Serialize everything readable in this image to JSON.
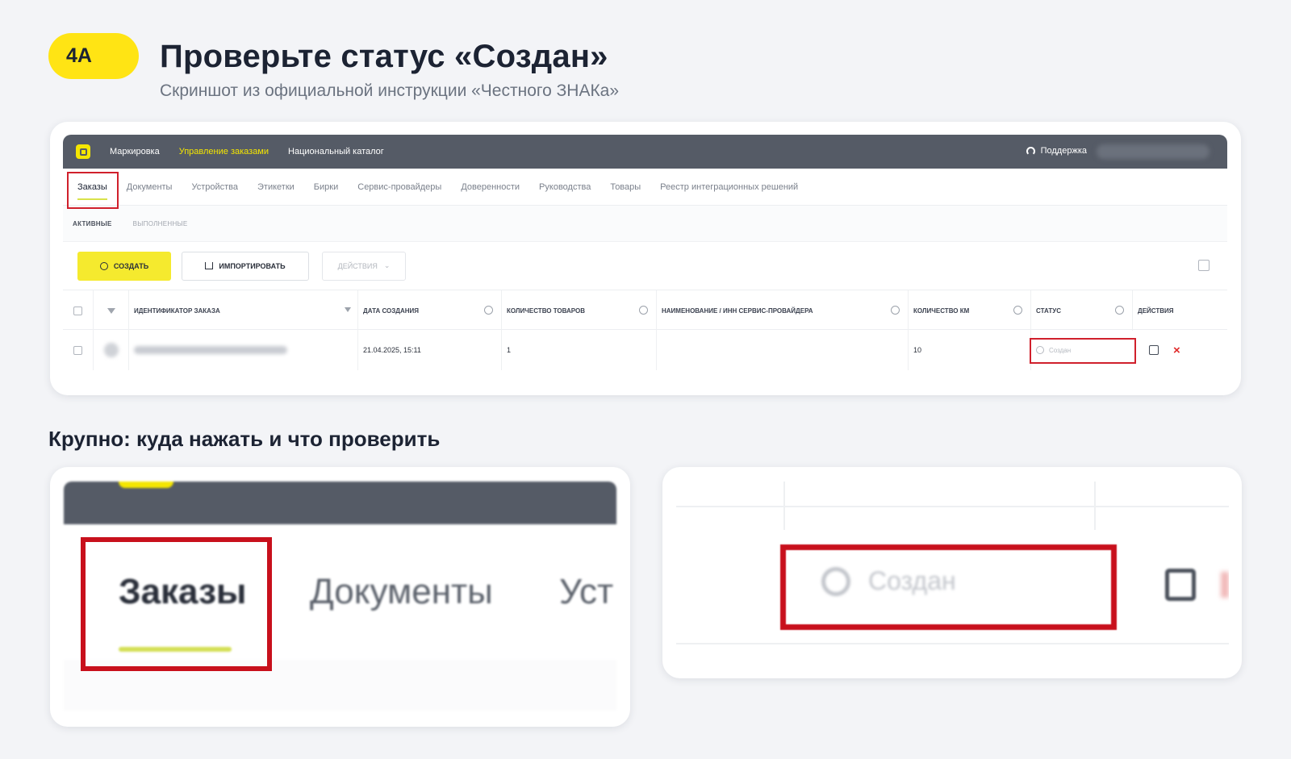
{
  "header": {
    "step": "4А",
    "title": "Проверьте статус «Создан»",
    "subtitle": "Скриншот из официальной инструкции «Честного ЗНАКа»"
  },
  "app": {
    "topnav": [
      "Маркировка",
      "Управление заказами",
      "Национальный каталог"
    ],
    "support": "Поддержка",
    "tabs": [
      "Заказы",
      "Документы",
      "Устройства",
      "Этикетки",
      "Бирки",
      "Сервис-провайдеры",
      "Доверенности",
      "Руководства",
      "Товары",
      "Реестр интеграционных решений"
    ],
    "subtabs": [
      "АКТИВНЫЕ",
      "ВЫПОЛНЕННЫЕ"
    ],
    "toolbar": {
      "create": "СОЗДАТЬ",
      "import": "ИМПОРТИРОВАТЬ",
      "actions": "ДЕЙСТВИЯ"
    },
    "table": {
      "headers": {
        "order_id": "ИДЕНТИФИКАТОР ЗАКАЗА",
        "created": "ДАТА СОЗДАНИЯ",
        "goods_count": "КОЛИЧЕСТВО ТОВАРОВ",
        "provider": "НАИМЕНОВАНИЕ / ИНН СЕРВИС-ПРОВАЙДЕРА",
        "km_count": "КОЛИЧЕСТВО КМ",
        "status": "СТАТУС",
        "actions": "ДЕЙСТВИЯ"
      },
      "row": {
        "created": "21.04.2025, 15:11",
        "goods_count": "1",
        "km_count": "10",
        "status": "Создан"
      }
    }
  },
  "section": {
    "heading": "Крупно: куда нажать и что проверить"
  },
  "zoom_left": {
    "tabs": [
      "Заказы",
      "Документы",
      "Уст"
    ]
  },
  "zoom_right": {
    "status": "Создан"
  },
  "colors": {
    "accent_yellow": "#ffe414",
    "highlight_red": "#d0202c",
    "topbar": "#555b66"
  }
}
